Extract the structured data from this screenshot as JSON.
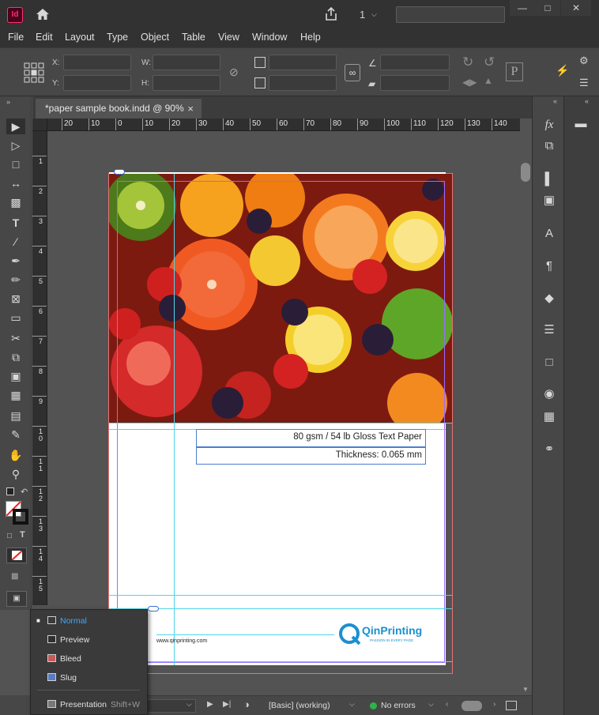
{
  "app": {
    "badge": "Id"
  },
  "titlebar": {
    "page_number": "1"
  },
  "menu": [
    "File",
    "Edit",
    "Layout",
    "Type",
    "Object",
    "Table",
    "View",
    "Window",
    "Help"
  ],
  "control": {
    "x_label": "X:",
    "y_label": "Y:",
    "w_label": "W:",
    "h_label": "H:"
  },
  "tab": {
    "title": "*paper sample book.indd @ 90%",
    "close": "×"
  },
  "hruler": [
    "20",
    "10",
    "0",
    "10",
    "20",
    "30",
    "40",
    "50",
    "60",
    "70",
    "80",
    "90",
    "100",
    "110",
    "120",
    "130",
    "140"
  ],
  "vruler": [
    "1",
    "2",
    "3",
    "4",
    "5",
    "6",
    "7",
    "8",
    "9",
    "10",
    "11",
    "12",
    "13",
    "14",
    "15"
  ],
  "page": {
    "spec_line1": "80 gsm / 54 lb Gloss Text Paper",
    "spec_line2": "Thickness: 0.065 mm",
    "website": "www.qinprinting.com",
    "logo_name": "QinPrinting",
    "logo_tagline": "PASSION IN EVERY PAGE"
  },
  "mode_menu": {
    "items": [
      {
        "label": "Normal",
        "selected": true
      },
      {
        "label": "Preview"
      },
      {
        "label": "Bleed"
      },
      {
        "label": "Slug"
      }
    ],
    "presentation": "Presentation",
    "presentation_shortcut": "Shift+W"
  },
  "status": {
    "style": "[Basic] (working)",
    "preflight": "No errors"
  },
  "colors": {
    "accent": "#3ea8ff",
    "ok": "#2fb344",
    "brand": "#1b8fd1",
    "bleed": "#e87373",
    "guide": "#4fd6e8"
  }
}
